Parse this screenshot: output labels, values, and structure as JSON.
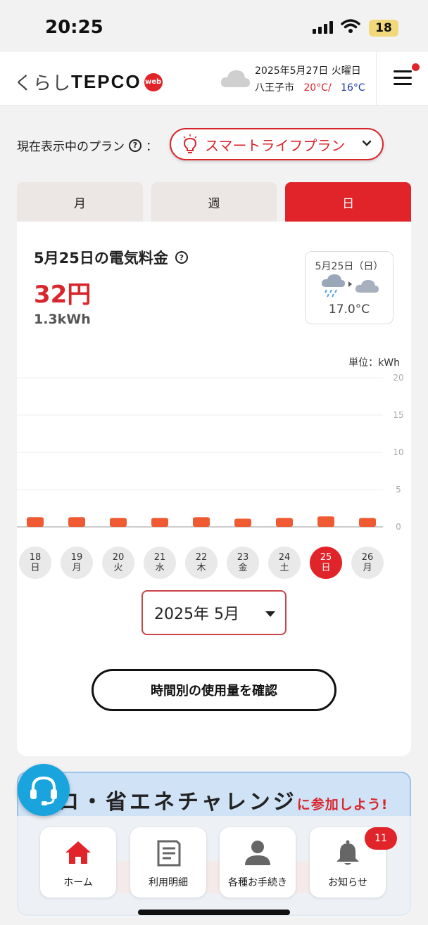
{
  "status_bar": {
    "time": "20:25",
    "battery": "18"
  },
  "header": {
    "logo_prefix": "くらし",
    "logo_brand": "TEPCO",
    "logo_web": "web",
    "date": "2025年5月27日 火曜日",
    "city": "八王子市",
    "temp_high": "20°C/",
    "temp_low": "16°C",
    "weather_icon": "cloud-icon",
    "notification_dot": true
  },
  "plan": {
    "label": "現在表示中のプラン",
    "colon": "：",
    "name": "スマートライフプラン",
    "icon": "lightbulb-icon"
  },
  "tabs": [
    {
      "label": "月",
      "active": false
    },
    {
      "label": "週",
      "active": false
    },
    {
      "label": "日",
      "active": true
    }
  ],
  "summary": {
    "title": "5月25日の電気料金",
    "cost": "32円",
    "usage": "1.3kWh"
  },
  "weather_box": {
    "date": "5月25日（日）",
    "icons": [
      "rain-cloud-icon",
      "cloud-icon"
    ],
    "temp": "17.0°C"
  },
  "chart_data": {
    "type": "bar",
    "unit_label": "単位：kWh",
    "categories": [
      "18日",
      "19日",
      "20日",
      "21日",
      "22日",
      "23日",
      "24日",
      "25日",
      "26日"
    ],
    "values": [
      1.3,
      1.3,
      1.2,
      1.2,
      1.3,
      1.1,
      1.2,
      1.4,
      1.2
    ],
    "ylim": [
      0,
      20
    ],
    "yticks": [
      "20",
      "15",
      "10",
      "5",
      "0"
    ],
    "color": "#f05a32",
    "grid": true
  },
  "days": [
    {
      "num": "18",
      "dow": "日",
      "active": false
    },
    {
      "num": "19",
      "dow": "月",
      "active": false
    },
    {
      "num": "20",
      "dow": "火",
      "active": false
    },
    {
      "num": "21",
      "dow": "水",
      "active": false
    },
    {
      "num": "22",
      "dow": "木",
      "active": false
    },
    {
      "num": "23",
      "dow": "金",
      "active": false
    },
    {
      "num": "24",
      "dow": "土",
      "active": false
    },
    {
      "num": "25",
      "dow": "日",
      "active": true
    },
    {
      "num": "26",
      "dow": "月",
      "active": false
    }
  ],
  "month_select": {
    "value": "2025年 5月"
  },
  "hourly_button": {
    "label": "時間別の使用量を確認"
  },
  "banner": {
    "text": "ロ・省エネチャレンジ",
    "suffix": "に参加しよう!"
  },
  "nav": [
    {
      "label": "ホーム",
      "icon": "home-icon",
      "active": true
    },
    {
      "label": "利用明細",
      "icon": "document-icon",
      "active": false
    },
    {
      "label": "各種お手続き",
      "icon": "person-icon",
      "active": false
    },
    {
      "label": "お知らせ",
      "icon": "bell-icon",
      "active": false
    }
  ],
  "notification_count": "11",
  "colors": {
    "accent": "#e0242a",
    "chart_bar": "#f05a32",
    "low_temp": "#1a37a8"
  }
}
